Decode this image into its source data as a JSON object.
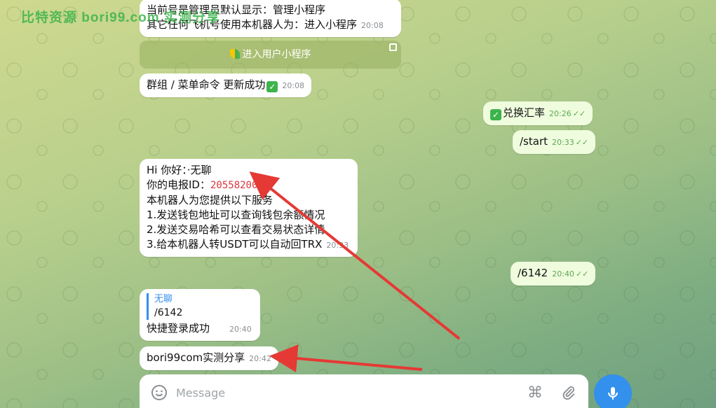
{
  "watermark": "比特资源 bori99.com 实测分享",
  "messages": {
    "m1": {
      "line1": "当前号是管理员默认显示：管理小程序",
      "line2": "其它任何飞机号使用本机器人为：进入小程序",
      "time": "20:08"
    },
    "inline_button": "进入用户小程序",
    "m2": {
      "text": "群组 / 菜单命令 更新成功",
      "time": "20:08"
    },
    "o1": {
      "text": "兑换汇率",
      "time": "20:26"
    },
    "o2": {
      "text": "/start",
      "time": "20:33"
    },
    "m3": {
      "greeting": "Hi 你好：·无聊",
      "id_label": "你的电报ID：",
      "id_value": "2055820092",
      "line3": "本机器人为您提供以下服务",
      "line4": "1.发送钱包地址可以查询钱包余额情况",
      "line5": "2.发送交易哈希可以查看交易状态详情",
      "line6": "3.给本机器人转USDT可以自动回TRX",
      "time": "20:33"
    },
    "o3": {
      "text": "/6142",
      "time": "20:40"
    },
    "m4": {
      "quote_name": "无聊",
      "quote_text": "/6142",
      "text": "快捷登录成功",
      "time": "20:40"
    },
    "m5": {
      "text": "bori99com实测分享",
      "time": "20:42"
    }
  },
  "composer": {
    "placeholder": "Message"
  },
  "colors": {
    "accent": "#3390ec",
    "outgoing": "#effdde",
    "arrow": "#e53935"
  },
  "icons": [
    "emoji-icon",
    "command-icon",
    "attach-icon",
    "mic-icon"
  ]
}
